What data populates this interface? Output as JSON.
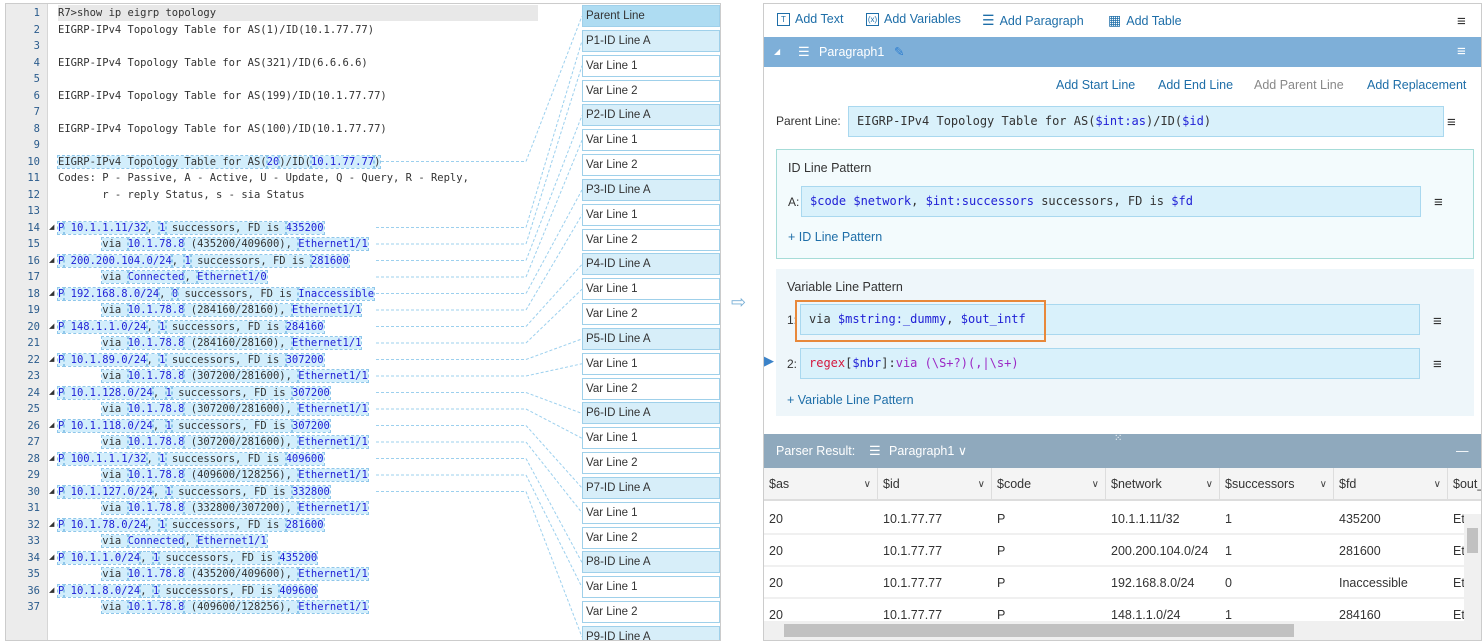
{
  "editor": {
    "lines": [
      [
        [
          "R7>show ip eigrp topology",
          ""
        ]
      ],
      [
        [
          "EIGRP-IPv4 Topology Table for AS(1)/ID(10.1.77.77)",
          ""
        ]
      ],
      [],
      [
        [
          "EIGRP-IPv4 Topology Table for AS(321)/ID(6.6.6.6)",
          ""
        ]
      ],
      [],
      [
        [
          "EIGRP-IPv4 Topology Table for AS(199)/ID(10.1.77.77)",
          ""
        ]
      ],
      [],
      [
        [
          "EIGRP-IPv4 Topology Table for AS(100)/ID(10.1.77.77)",
          ""
        ]
      ],
      [],
      [
        [
          "EIGRP-IPv4 Topology Table for AS(",
          "h"
        ],
        [
          "20",
          "hv"
        ],
        [
          ")/ID(",
          "h"
        ],
        [
          "10.1.77.77",
          "hv"
        ],
        [
          ")",
          "h"
        ]
      ],
      [
        [
          "Codes: P - Passive, A - Active, U - Update, Q - Query, R - Reply,",
          ""
        ]
      ],
      [
        [
          "       r - reply Status, s - sia Status",
          ""
        ]
      ],
      [],
      [
        [
          "P",
          "hv"
        ],
        [
          " 10.1.1.11/32",
          "hv"
        ],
        [
          ", ",
          "h"
        ],
        [
          "1",
          "hv"
        ],
        [
          " successors, FD is ",
          "h"
        ],
        [
          "435200",
          "hv"
        ]
      ],
      [
        [
          "       ",
          ""
        ],
        [
          "via ",
          "h"
        ],
        [
          "10.1.78.8",
          "hv"
        ],
        [
          " (435200/409600), ",
          "h"
        ],
        [
          "Ethernet1/1",
          "hv"
        ]
      ],
      [
        [
          "P",
          "hv"
        ],
        [
          " 200.200.104.0/24",
          "hv"
        ],
        [
          ", ",
          "h"
        ],
        [
          "1",
          "hv"
        ],
        [
          " successors, FD is ",
          "h"
        ],
        [
          "281600",
          "hv"
        ]
      ],
      [
        [
          "       ",
          ""
        ],
        [
          "via ",
          "h"
        ],
        [
          "Connected",
          "hv"
        ],
        [
          ", ",
          "h"
        ],
        [
          "Ethernet1/0",
          "hv"
        ]
      ],
      [
        [
          "P",
          "hv"
        ],
        [
          " 192.168.8.0/24",
          "hv"
        ],
        [
          ", ",
          "h"
        ],
        [
          "0",
          "hv"
        ],
        [
          " successors, FD is ",
          "h"
        ],
        [
          "Inaccessible",
          "hv"
        ]
      ],
      [
        [
          "       ",
          ""
        ],
        [
          "via ",
          "h"
        ],
        [
          "10.1.78.8",
          "hv"
        ],
        [
          " (284160/28160), ",
          "h"
        ],
        [
          "Ethernet1/1",
          "hv"
        ]
      ],
      [
        [
          "P",
          "hv"
        ],
        [
          " 148.1.1.0/24",
          "hv"
        ],
        [
          ", ",
          "h"
        ],
        [
          "1",
          "hv"
        ],
        [
          " successors, FD is ",
          "h"
        ],
        [
          "284160",
          "hv"
        ]
      ],
      [
        [
          "       ",
          ""
        ],
        [
          "via ",
          "h"
        ],
        [
          "10.1.78.8",
          "hv"
        ],
        [
          " (284160/28160), ",
          "h"
        ],
        [
          "Ethernet1/1",
          "hv"
        ]
      ],
      [
        [
          "P",
          "hv"
        ],
        [
          " 10.1.89.0/24",
          "hv"
        ],
        [
          ", ",
          "h"
        ],
        [
          "1",
          "hv"
        ],
        [
          " successors, FD is ",
          "h"
        ],
        [
          "307200",
          "hv"
        ]
      ],
      [
        [
          "       ",
          ""
        ],
        [
          "via ",
          "h"
        ],
        [
          "10.1.78.8",
          "hv"
        ],
        [
          " (307200/281600), ",
          "h"
        ],
        [
          "Ethernet1/1",
          "hv"
        ]
      ],
      [
        [
          "P",
          "hv"
        ],
        [
          " 10.1.128.0/24",
          "hv"
        ],
        [
          ", ",
          "h"
        ],
        [
          "1",
          "hv"
        ],
        [
          " successors, FD is ",
          "h"
        ],
        [
          "307200",
          "hv"
        ]
      ],
      [
        [
          "       ",
          ""
        ],
        [
          "via ",
          "h"
        ],
        [
          "10.1.78.8",
          "hv"
        ],
        [
          " (307200/281600), ",
          "h"
        ],
        [
          "Ethernet1/1",
          "hv"
        ]
      ],
      [
        [
          "P",
          "hv"
        ],
        [
          " 10.1.118.0/24",
          "hv"
        ],
        [
          ", ",
          "h"
        ],
        [
          "1",
          "hv"
        ],
        [
          " successors, FD is ",
          "h"
        ],
        [
          "307200",
          "hv"
        ]
      ],
      [
        [
          "       ",
          ""
        ],
        [
          "via ",
          "h"
        ],
        [
          "10.1.78.8",
          "hv"
        ],
        [
          " (307200/281600), ",
          "h"
        ],
        [
          "Ethernet1/1",
          "hv"
        ]
      ],
      [
        [
          "P",
          "hv"
        ],
        [
          " 100.1.1.1/32",
          "hv"
        ],
        [
          ", ",
          "h"
        ],
        [
          "1",
          "hv"
        ],
        [
          " successors, FD is ",
          "h"
        ],
        [
          "409600",
          "hv"
        ]
      ],
      [
        [
          "       ",
          ""
        ],
        [
          "via ",
          "h"
        ],
        [
          "10.1.78.8",
          "hv"
        ],
        [
          " (409600/128256), ",
          "h"
        ],
        [
          "Ethernet1/1",
          "hv"
        ]
      ],
      [
        [
          "P",
          "hv"
        ],
        [
          " 10.1.127.0/24",
          "hv"
        ],
        [
          ", ",
          "h"
        ],
        [
          "1",
          "hv"
        ],
        [
          " successors, FD is ",
          "h"
        ],
        [
          "332800",
          "hv"
        ]
      ],
      [
        [
          "       ",
          ""
        ],
        [
          "via ",
          "h"
        ],
        [
          "10.1.78.8",
          "hv"
        ],
        [
          " (332800/307200), ",
          "h"
        ],
        [
          "Ethernet1/1",
          "hv"
        ]
      ],
      [
        [
          "P",
          "hv"
        ],
        [
          " 10.1.78.0/24",
          "hv"
        ],
        [
          ", ",
          "h"
        ],
        [
          "1",
          "hv"
        ],
        [
          " successors, FD is ",
          "h"
        ],
        [
          "281600",
          "hv"
        ]
      ],
      [
        [
          "       ",
          ""
        ],
        [
          "via ",
          "h"
        ],
        [
          "Connected",
          "hv"
        ],
        [
          ", ",
          "h"
        ],
        [
          "Ethernet1/1",
          "hv"
        ]
      ],
      [
        [
          "P",
          "hv"
        ],
        [
          " 10.1.1.0/24",
          "hv"
        ],
        [
          ", ",
          "h"
        ],
        [
          "1",
          "hv"
        ],
        [
          " successors, FD is ",
          "h"
        ],
        [
          "435200",
          "hv"
        ]
      ],
      [
        [
          "       ",
          ""
        ],
        [
          "via ",
          "h"
        ],
        [
          "10.1.78.8",
          "hv"
        ],
        [
          " (435200/409600), ",
          "h"
        ],
        [
          "Ethernet1/1",
          "hv"
        ]
      ],
      [
        [
          "P",
          "hv"
        ],
        [
          " 10.1.8.0/24",
          "hv"
        ],
        [
          ", ",
          "h"
        ],
        [
          "1",
          "hv"
        ],
        [
          " successors, FD is ",
          "h"
        ],
        [
          "409600",
          "hv"
        ]
      ],
      [
        [
          "       ",
          ""
        ],
        [
          "via ",
          "h"
        ],
        [
          "10.1.78.8",
          "hv"
        ],
        [
          " (409600/128256), ",
          "h"
        ],
        [
          "Ethernet1/1",
          "hv"
        ]
      ]
    ]
  },
  "labels": [
    "Parent Line",
    "P1-ID Line A",
    "Var Line 1",
    "Var Line 2",
    "P2-ID Line A",
    "Var Line 1",
    "Var Line 2",
    "P3-ID Line A",
    "Var Line 1",
    "Var Line 2",
    "P4-ID Line A",
    "Var Line 1",
    "Var Line 2",
    "P5-ID Line A",
    "Var Line 1",
    "Var Line 2",
    "P6-ID Line A",
    "Var Line 1",
    "Var Line 2",
    "P7-ID Line A",
    "Var Line 1",
    "Var Line 2",
    "P8-ID Line A",
    "Var Line 1",
    "Var Line 2",
    "P9-ID Line A"
  ],
  "toolbar": {
    "add_text": "Add Text",
    "add_variables": "Add Variables",
    "add_paragraph": "Add Paragraph",
    "add_table": "Add Table"
  },
  "paragraph": {
    "name": "Paragraph1",
    "links": {
      "start": "Add Start Line",
      "end": "Add End Line",
      "parent": "Add Parent Line",
      "replacement": "Add Replacement"
    },
    "parent_label": "Parent Line:",
    "parent_line": {
      "a": "EIGRP-IPv4 Topology Table for AS(",
      "b": "$int:as",
      "c": ")/ID(",
      "d": "$id",
      "e": ")"
    },
    "id_section": {
      "title": "ID Line Pattern",
      "label": "A:",
      "p1": "$code $network",
      "p2": ", ",
      "p3": "$int:successors",
      "p4": " successors, FD is ",
      "p5": "$fd",
      "add": "+ ID Line Pattern"
    },
    "var_section": {
      "title": "Variable Line Pattern",
      "l1": "1:",
      "v1a": "via ",
      "v1b": "$mstring:_dummy",
      "v1c": ", ",
      "v1d": "$out_intf",
      "l2": "2:",
      "v2a": "regex",
      "v2b": "[",
      "v2c": "$nbr",
      "v2d": "]:",
      "v2e": "via (\\S+?)(,|\\s+)",
      "add": "+ Variable Line Pattern"
    }
  },
  "result": {
    "label": "Parser Result:",
    "paragraph": "Paragraph1",
    "columns": [
      "$as",
      "$id",
      "$code",
      "$network",
      "$successors",
      "$fd",
      "$out_"
    ],
    "rows": [
      [
        "20",
        "10.1.77.77",
        "P",
        "10.1.1.11/32",
        "1",
        "435200",
        "Et"
      ],
      [
        "20",
        "10.1.77.77",
        "P",
        "200.200.104.0/24",
        "1",
        "281600",
        "Et"
      ],
      [
        "20",
        "10.1.77.77",
        "P",
        "192.168.8.0/24",
        "0",
        "Inaccessible",
        "Et"
      ],
      [
        "20",
        "10.1.77.77",
        "P",
        "148.1.1.0/24",
        "1",
        "284160",
        "Et"
      ]
    ]
  },
  "colors": {
    "accent": "#1e6ea8",
    "header": "#7eafd8",
    "highlight": "#d2eefc",
    "orange": "#e8883a"
  }
}
